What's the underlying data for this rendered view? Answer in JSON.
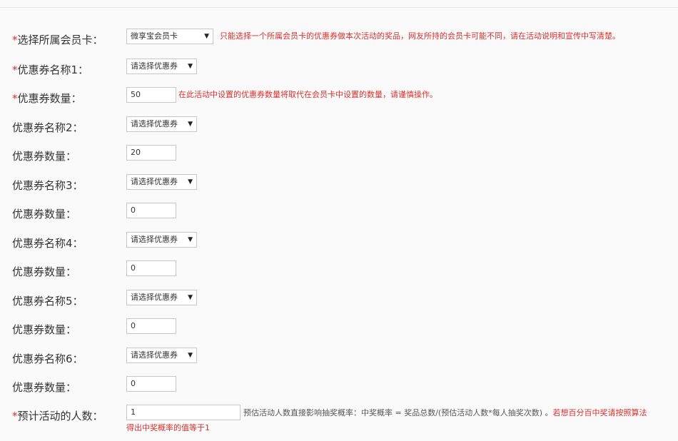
{
  "member_card": {
    "label": "选择所属会员卡：",
    "selected": "微享宝会员卡",
    "hint": "只能选择一个所属会员卡的优惠券做本次活动的奖品，网友所持的会员卡可能不同，请在活动说明和宣传中写清楚。"
  },
  "coupon1": {
    "name_label": "优惠券名称1：",
    "name_selected": "请选择优惠券",
    "qty_label": "优惠券数量：",
    "qty_value": "50",
    "qty_hint": "在此活动中设置的优惠券数量将取代在会员卡中设置的数量，请谨慎操作。"
  },
  "coupon2": {
    "name_label": "优惠券名称2：",
    "name_selected": "请选择优惠券",
    "qty_label": "优惠券数量：",
    "qty_value": "20"
  },
  "coupon3": {
    "name_label": "优惠券名称3：",
    "name_selected": "请选择优惠券",
    "qty_label": "优惠券数量：",
    "qty_value": "0"
  },
  "coupon4": {
    "name_label": "优惠券名称4：",
    "name_selected": "请选择优惠券",
    "qty_label": "优惠券数量：",
    "qty_value": "0"
  },
  "coupon5": {
    "name_label": "优惠券名称5：",
    "name_selected": "请选择优惠券",
    "qty_label": "优惠券数量：",
    "qty_value": "0"
  },
  "coupon6": {
    "name_label": "优惠券名称6：",
    "name_selected": "请选择优惠券",
    "qty_label": "优惠券数量：",
    "qty_value": "0"
  },
  "participants": {
    "label": "预计活动的人数：",
    "value": "1",
    "hint_gray": "预估活动人数直接影响抽奖概率：中奖概率 = 奖品总数/(预估活动人数*每人抽奖次数) 。",
    "hint_red": "若想百分百中奖请按照算法",
    "hint_red_line2": "得出中奖概率的值等于1"
  },
  "required_mark": "*",
  "caret_glyph": "▼"
}
